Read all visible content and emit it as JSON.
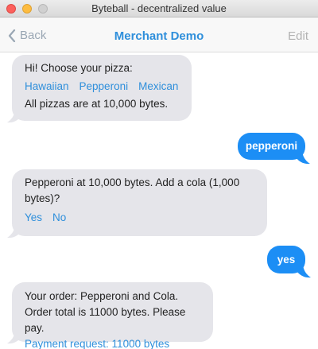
{
  "window": {
    "title": "Byteball - decentralized value"
  },
  "nav": {
    "back_label": "Back",
    "title": "Merchant Demo",
    "edit_label": "Edit"
  },
  "messages": {
    "m1": {
      "line1": "Hi! Choose your pizza:",
      "options": [
        "Hawaiian",
        "Pepperoni",
        "Mexican"
      ],
      "line3": "All pizzas are at 10,000 bytes."
    },
    "m2": {
      "text": "pepperoni"
    },
    "m3": {
      "line1": "Pepperoni at 10,000 bytes. Add a cola (1,000",
      "line2": "bytes)?",
      "options": [
        "Yes",
        "No"
      ]
    },
    "m4": {
      "text": "yes"
    },
    "m5": {
      "line1": "Your order: Pepperoni and Cola.",
      "line2": "Order total is 11000 bytes. Please pay.",
      "link": "Payment request: 11000 bytes"
    }
  },
  "colors": {
    "accent": "#2f8fdb",
    "outgoing_bubble": "#1c8ef5",
    "incoming_bubble": "#e5e5ea"
  }
}
